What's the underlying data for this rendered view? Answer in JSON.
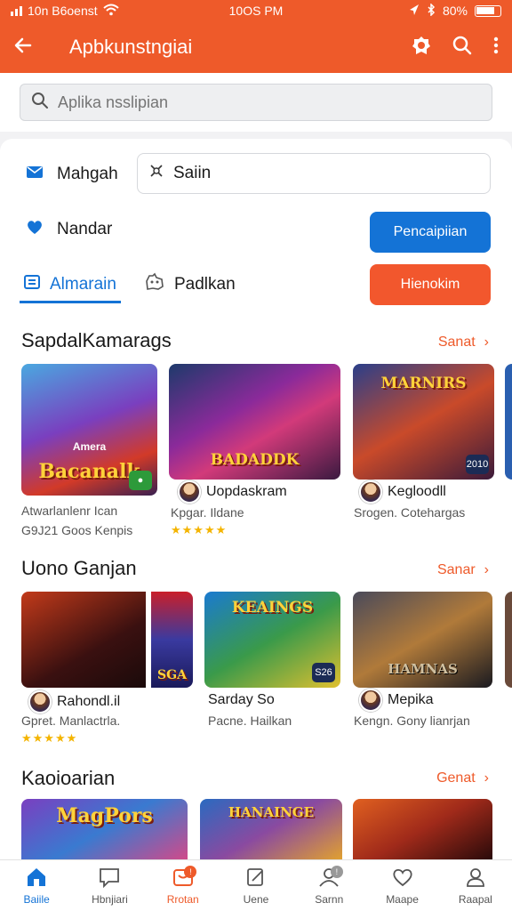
{
  "status_bar": {
    "carrier": "10n B6oenst",
    "time": "10OS PM",
    "battery": "80%"
  },
  "header": {
    "title": "Apbkunstngiai"
  },
  "search": {
    "placeholder": "Aplika nsslipian"
  },
  "form": {
    "row1_label": "Mahgah",
    "row1_field_value": "Saiin",
    "row2_label": "Nandar",
    "primary_button": "Pencaipiian",
    "secondary_button": "Hienokim"
  },
  "tabs": [
    {
      "label": "Almarain"
    },
    {
      "label": "Padlkan"
    }
  ],
  "sections": [
    {
      "title": "SapdalKamarags",
      "more": "Sanat",
      "items": [
        {
          "art_title": "Bacanalk",
          "art_subtitle": "Amera",
          "name": "",
          "meta1": "Atwarlanlenr Ican",
          "meta2": "G9J21 Goos Kenpis",
          "rating": "",
          "badge": ""
        },
        {
          "art_title": "BADADDK",
          "art_subtitle": "",
          "name": "Uopdaskram",
          "meta1": "Kpgar. Ildane",
          "meta2": "",
          "rating": "★★★★★",
          "badge": ""
        },
        {
          "art_title": "MARNIRS",
          "art_subtitle": "",
          "name": "Kegloodll",
          "meta1": "Srogen. Cotehargas",
          "meta2": "",
          "rating": "",
          "badge": "2010"
        }
      ]
    },
    {
      "title": "Uono Ganjan",
      "more": "Sanar",
      "items": [
        {
          "art_title": "SGA",
          "art_subtitle": "",
          "name": "Rahondl.il",
          "meta1": "Gpret. Manlactrla.",
          "meta2": "",
          "rating": "★★★★★",
          "badge": ""
        },
        {
          "art_title": "KEAINGS",
          "art_subtitle": "",
          "name": "Sarday So",
          "meta1": "Pacne. Hailkan",
          "meta2": "",
          "rating": "",
          "badge": "S26"
        },
        {
          "art_title": "HAMNAS",
          "art_subtitle": "",
          "name": "Mepika",
          "meta1": "Kengn. Gony lianrjan",
          "meta2": "",
          "rating": "",
          "badge": ""
        }
      ]
    },
    {
      "title": "Kaoioarian",
      "more": "Genat",
      "items": [
        {
          "art_title": "MagPors"
        },
        {
          "art_title": "HANAINGE"
        },
        {
          "art_title": ""
        }
      ]
    }
  ],
  "bottom_nav": [
    {
      "label": "Baiile"
    },
    {
      "label": "Hbnjiari"
    },
    {
      "label": "Rrotan"
    },
    {
      "label": "Uene"
    },
    {
      "label": "Sarnn"
    },
    {
      "label": "Maape"
    },
    {
      "label": "Raapal"
    }
  ],
  "colors": {
    "brand": "#ee5a2a",
    "accent": "#1473d6"
  }
}
